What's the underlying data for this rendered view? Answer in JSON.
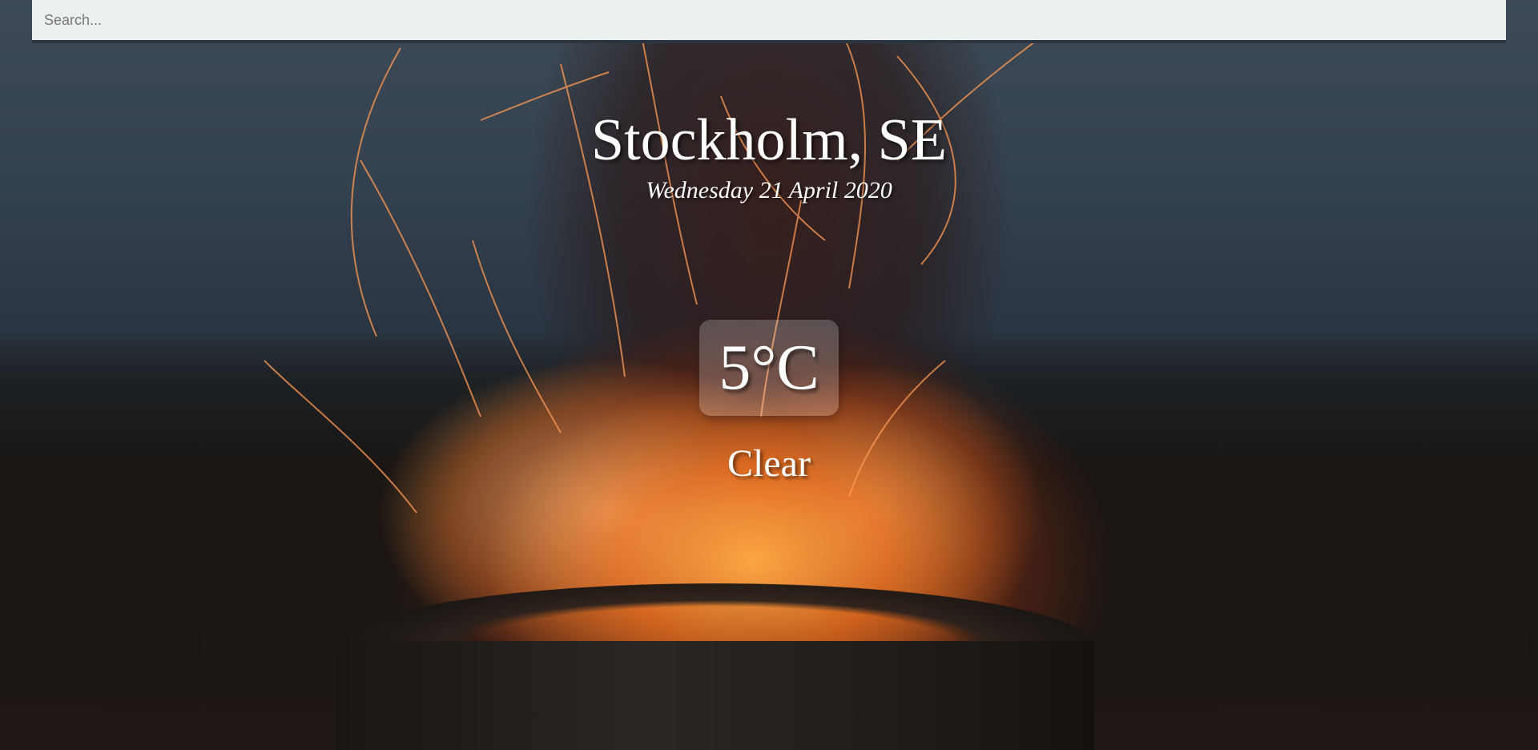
{
  "search": {
    "placeholder": "Search...",
    "value": ""
  },
  "location": {
    "name": "Stockholm, SE",
    "date": "Wednesday 21 April 2020"
  },
  "weather": {
    "temperature": "5°C",
    "condition": "Clear"
  },
  "colors": {
    "text": "#ffffff",
    "search_background": "#eceff0",
    "search_border": "#2b3540"
  },
  "background": {
    "scene": "campfire-in-firepit-at-dusk"
  }
}
